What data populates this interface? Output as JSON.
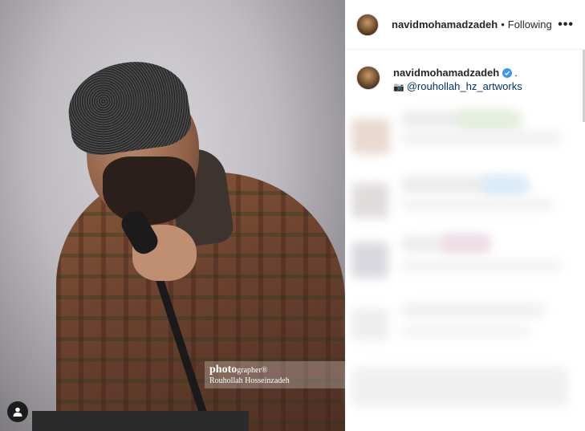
{
  "post": {
    "author": "navidmohamadzadeh",
    "follow_state": "Following",
    "more_label": "•••",
    "separator": "•",
    "icons": {
      "more": "more-horizontal-icon",
      "verified": "verified-badge-icon",
      "user_tags": "user-tag-icon",
      "camera": "camera-emoji-icon"
    }
  },
  "caption": {
    "username": "navidmohamadzadeh",
    "trailing": ".",
    "camera_emoji": "📷",
    "tag": "@rouhollah_hz_artworks"
  },
  "photo": {
    "watermark_title_bold": "photo",
    "watermark_title_rest": "grapher",
    "watermark_title_mark": "®",
    "watermark_name": "Rouhollah Hosseinzadeh"
  },
  "colors": {
    "link": "#003569",
    "verified": "#3897f0",
    "text": "#262626"
  }
}
